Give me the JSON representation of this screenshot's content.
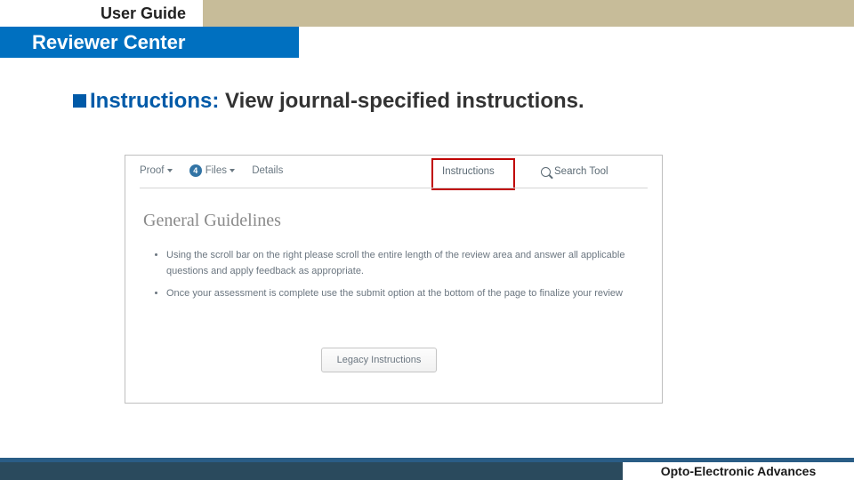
{
  "header": {
    "title": "User Guide",
    "subtitle": "Reviewer Center"
  },
  "main": {
    "bullet_label": "Instructions:",
    "bullet_text": " View journal-specified instructions."
  },
  "screenshot": {
    "tabs": {
      "proof": "Proof",
      "files_badge": "4",
      "files": "Files",
      "details": "Details",
      "instructions": "Instructions",
      "search_tool": "Search Tool"
    },
    "heading": "General Guidelines",
    "bullets": [
      "Using the scroll bar on the right please scroll the entire length of the review area and answer all applicable questions and apply feedback as appropriate.",
      "Once your assessment is complete use the submit option at the bottom of the page to finalize your review"
    ],
    "legacy_button": "Legacy Instructions"
  },
  "footer": {
    "journal": "Opto-Electronic Advances"
  }
}
